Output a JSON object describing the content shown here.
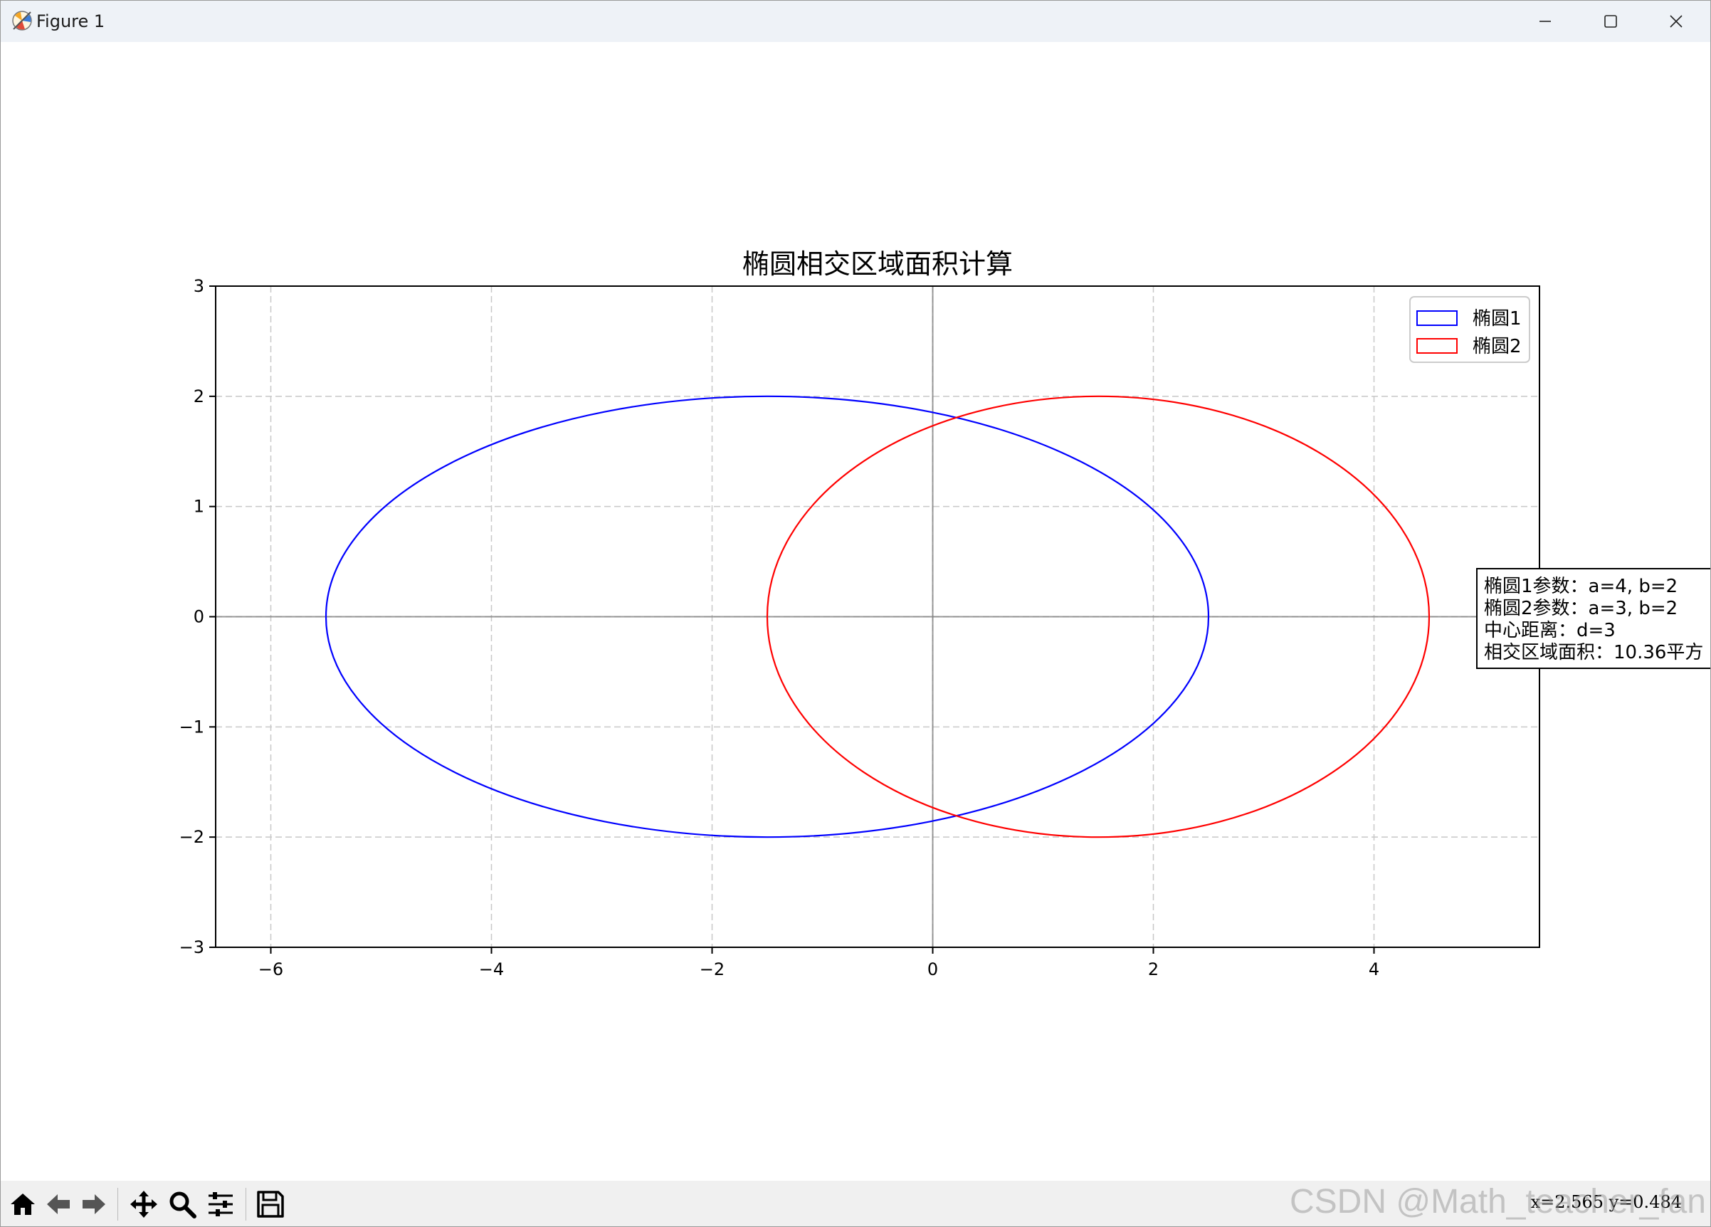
{
  "window": {
    "title": "Figure 1",
    "icons": {
      "app": "matplotlib-icon",
      "minimize": "minimize-icon",
      "maximize": "maximize-icon",
      "close": "close-icon"
    }
  },
  "toolbar": {
    "buttons": [
      {
        "name": "home",
        "icon": "home-icon"
      },
      {
        "name": "back",
        "icon": "arrow-left-icon"
      },
      {
        "name": "forward",
        "icon": "arrow-right-icon"
      },
      {
        "name": "pan",
        "icon": "move-icon"
      },
      {
        "name": "zoom",
        "icon": "magnifier-icon"
      },
      {
        "name": "configure",
        "icon": "sliders-icon"
      },
      {
        "name": "save",
        "icon": "floppy-disk-icon"
      }
    ],
    "coords": "x=2.565 y=0.484"
  },
  "watermark": "CSDN @Math_teacher_fan",
  "colors": {
    "ellipse1": "#0000ff",
    "ellipse2": "#ff0000",
    "grid": "#c8c8c8",
    "axis_line": "#808080"
  },
  "chart_data": {
    "type": "line",
    "title": "椭圆相交区域面积计算",
    "xlabel": "",
    "ylabel": "",
    "xlim": [
      -6.5,
      5.5
    ],
    "ylim": [
      -3,
      3
    ],
    "xticks": [
      -6,
      -4,
      -2,
      0,
      2,
      4
    ],
    "yticks": [
      -3,
      -2,
      -1,
      0,
      1,
      2,
      3
    ],
    "xtick_labels": [
      "−6",
      "−4",
      "−2",
      "0",
      "2",
      "4"
    ],
    "ytick_labels": [
      "−3",
      "−2",
      "−1",
      "0",
      "1",
      "2",
      "3"
    ],
    "grid": true,
    "grid_style": "dashed",
    "reference_lines": {
      "x": 0,
      "y": 0
    },
    "legend_position": "upper-right",
    "series": [
      {
        "name": "椭圆1",
        "shape": "ellipse",
        "center": [
          -1.5,
          0
        ],
        "a": 4,
        "b": 2,
        "color": "#0000ff"
      },
      {
        "name": "椭圆2",
        "shape": "ellipse",
        "center": [
          1.5,
          0
        ],
        "a": 3,
        "b": 2,
        "color": "#ff0000"
      }
    ],
    "annotation": {
      "lines": [
        "椭圆1参数：a=4, b=2",
        "椭圆2参数：a=3, b=2",
        "中心距离：d=3",
        "相交区域面积：10.36平方"
      ]
    }
  }
}
